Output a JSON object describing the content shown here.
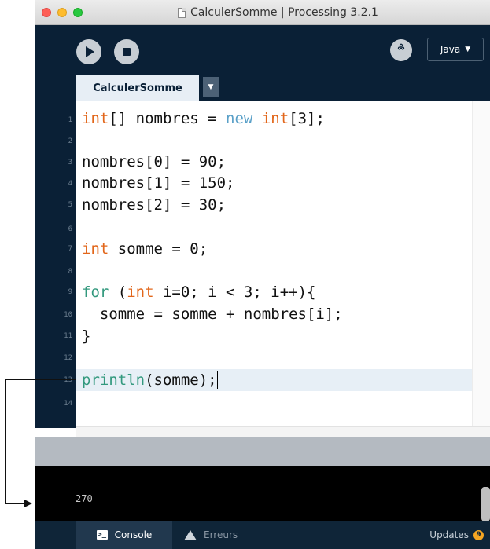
{
  "window": {
    "title": "CalculerSomme | Processing 3.2.1"
  },
  "toolbar": {
    "mode_icon": "༜",
    "mode_label": "Java",
    "mode_caret": "▼"
  },
  "tabs": [
    {
      "label": "CalculerSomme",
      "menu": "▼"
    }
  ],
  "editor": {
    "line_numbers": [
      "1",
      "2",
      "3",
      "4",
      "5",
      "6",
      "7",
      "8",
      "9",
      "10",
      "11",
      "12",
      "13",
      "14"
    ],
    "lines": [
      "int[] nombres = new int[3];",
      "",
      "nombres[0] = 90;",
      "nombres[1] = 150;",
      "nombres[2] = 30;",
      "",
      "int somme = 0;",
      "",
      "for (int i=0; i < 3; i++){",
      "  somme = somme + nombres[i];",
      "}",
      "",
      "println(somme);",
      ""
    ],
    "current_line": 13
  },
  "console": {
    "output": "270"
  },
  "footer": {
    "console_label": "Console",
    "errors_label": "Erreurs",
    "updates_label": "Updates",
    "updates_count": "9"
  },
  "colors": {
    "toolbar_bg": "#0a2036",
    "keyword": "#e2661a",
    "new_keyword": "#5aa0c8",
    "badge": "#f5a623"
  },
  "icons": [
    "play-icon",
    "stop-icon",
    "mode-icon",
    "console-icon",
    "warning-icon",
    "document-icon"
  ]
}
